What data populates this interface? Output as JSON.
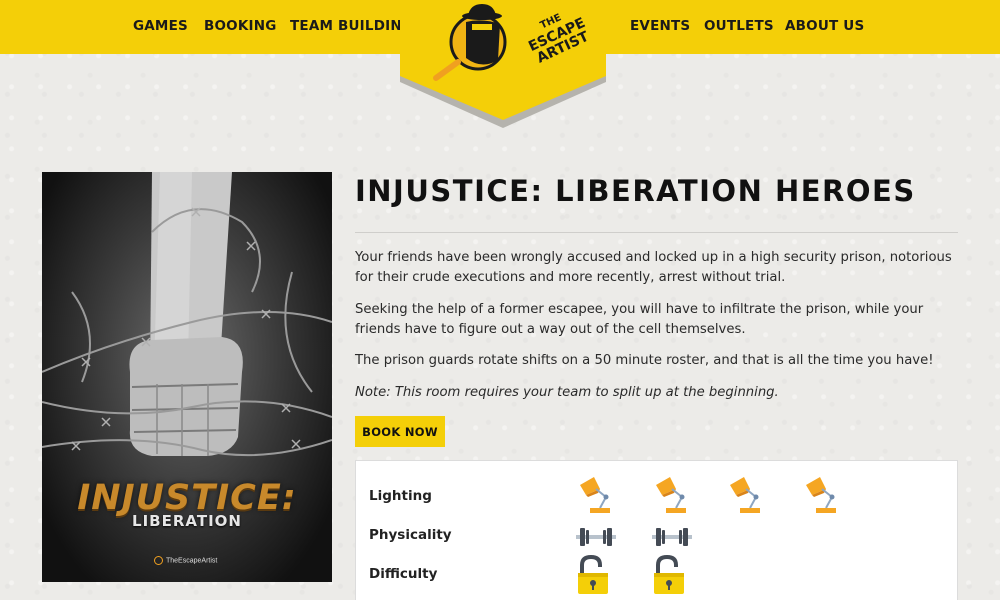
{
  "nav": {
    "left": [
      "GAMES",
      "BOOKING",
      "TEAM BUILDING"
    ],
    "right": [
      "EVENTS",
      "OUTLETS",
      "ABOUT US"
    ]
  },
  "logo": {
    "line1": "THE",
    "line2": "ESCAPE",
    "line3": "ARTIST"
  },
  "poster": {
    "title": "INJUSTICE:",
    "subtitle": "LIBERATION",
    "brand": "TheEscapeArtist"
  },
  "room": {
    "title": "INJUSTICE: LIBERATION HEROES",
    "paragraphs": [
      "Your friends have been wrongly accused and locked up in a high security prison, notorious for their crude executions and more recently, arrest without trial.",
      "Seeking the help of a former escapee, you will have to infiltrate the prison, while your friends have to figure out a way out of the cell themselves.",
      "The prison guards rotate shifts on a 50 minute roster, and that is all the time you have!"
    ],
    "note": "Note: This room requires your team to split up at the beginning.",
    "book_label": "BOOK NOW"
  },
  "ratings": [
    {
      "label": "Lighting",
      "icon": "desk-lamp-icon",
      "count": 4
    },
    {
      "label": "Physicality",
      "icon": "dumbbell-icon",
      "count": 2
    },
    {
      "label": "Difficulty",
      "icon": "padlock-icon",
      "count": 2
    }
  ],
  "colors": {
    "brand_yellow": "#f4cf08",
    "lamp_orange": "#f5a623",
    "lock_dark": "#444b55"
  }
}
